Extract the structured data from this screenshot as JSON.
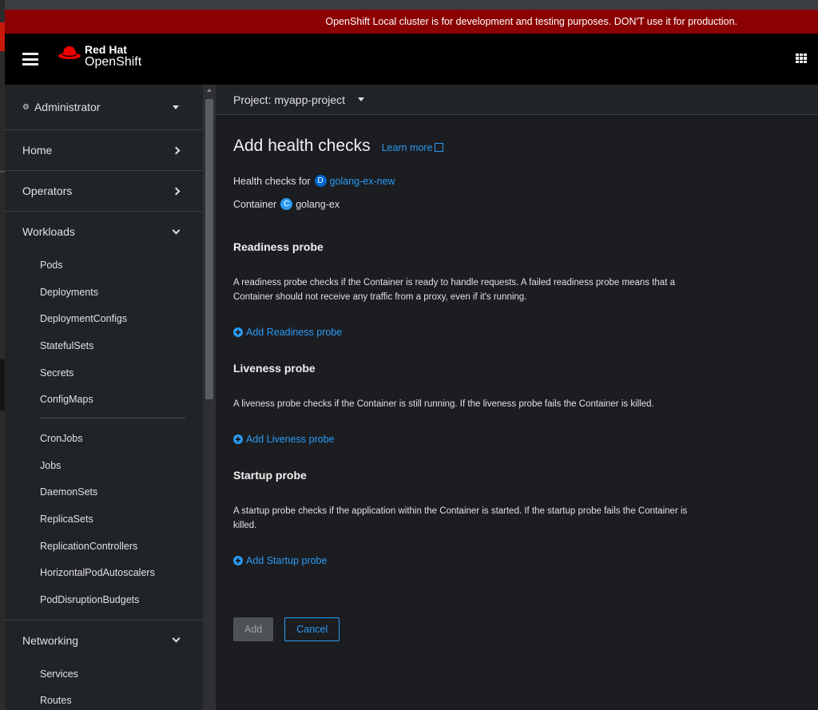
{
  "banner": {
    "text": "OpenShift Local cluster is for development and testing purposes. DON'T use it for production."
  },
  "masthead": {
    "logo_line1": "Red Hat",
    "logo_line2": "OpenShift"
  },
  "sidebar": {
    "perspective": "Administrator",
    "sections": [
      {
        "label": "Home"
      },
      {
        "label": "Operators"
      }
    ],
    "workloads": {
      "label": "Workloads",
      "items": [
        "Pods",
        "Deployments",
        "DeploymentConfigs",
        "StatefulSets",
        "Secrets",
        "ConfigMaps"
      ],
      "items2": [
        "CronJobs",
        "Jobs",
        "DaemonSets",
        "ReplicaSets",
        "ReplicationControllers",
        "HorizontalPodAutoscalers",
        "PodDisruptionBudgets"
      ]
    },
    "networking": {
      "label": "Networking",
      "items": [
        "Services",
        "Routes"
      ]
    }
  },
  "project": {
    "label": "Project: myapp-project"
  },
  "page": {
    "title": "Add health checks",
    "learn_more": "Learn more",
    "health_checks_for": "Health checks for",
    "deployment_badge": "D",
    "deployment_name": "golang-ex-new",
    "container_label": "Container",
    "container_badge": "C",
    "container_name": "golang-ex",
    "readiness": {
      "title": "Readiness probe",
      "description": "A readiness probe checks if the Container is ready to handle requests. A failed readiness probe means that a Container should not receive any traffic from a proxy, even if it's running.",
      "add_label": "Add Readiness probe"
    },
    "liveness": {
      "title": "Liveness probe",
      "description": "A liveness probe checks if the Container is still running. If the liveness probe fails the Container is killed.",
      "add_label": "Add Liveness probe"
    },
    "startup": {
      "title": "Startup probe",
      "description": "A startup probe checks if the application within the Container is started. If the startup probe fails the Container is killed.",
      "add_label": "Add Startup probe"
    },
    "add_button": "Add",
    "cancel_button": "Cancel"
  }
}
